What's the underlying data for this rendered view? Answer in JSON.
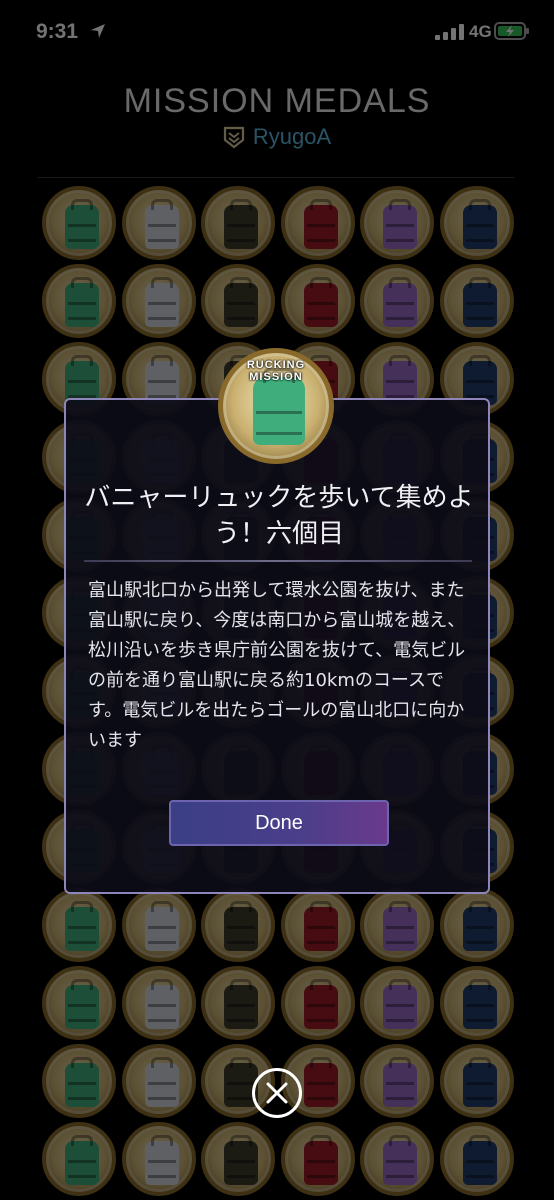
{
  "status_bar": {
    "time": "9:31",
    "network": "4G"
  },
  "header": {
    "title": "MISSION MEDALS",
    "username": "RyugoA"
  },
  "medal_colors": [
    "#3fae7c",
    "#d2d4dc",
    "#3d3a2c",
    "#9c1c28",
    "#9a6ac8",
    "#223c6a"
  ],
  "medal_grid_rows": 13,
  "featured_medal": {
    "banner": "RUCKING MISSION",
    "color": "#3fae7c"
  },
  "dialog": {
    "title": "バニャーリュックを歩いて集めよう！六個目",
    "body": "富山駅北口から出発して環水公園を抜け、また富山駅に戻り、今度は南口から富山城を越え、松川沿いを歩き県庁前公園を抜けて、電気ビルの前を通り富山駅に戻る約10kmのコースです。電気ビルを出たらゴールの富山北口に向かいます",
    "done_label": "Done"
  }
}
